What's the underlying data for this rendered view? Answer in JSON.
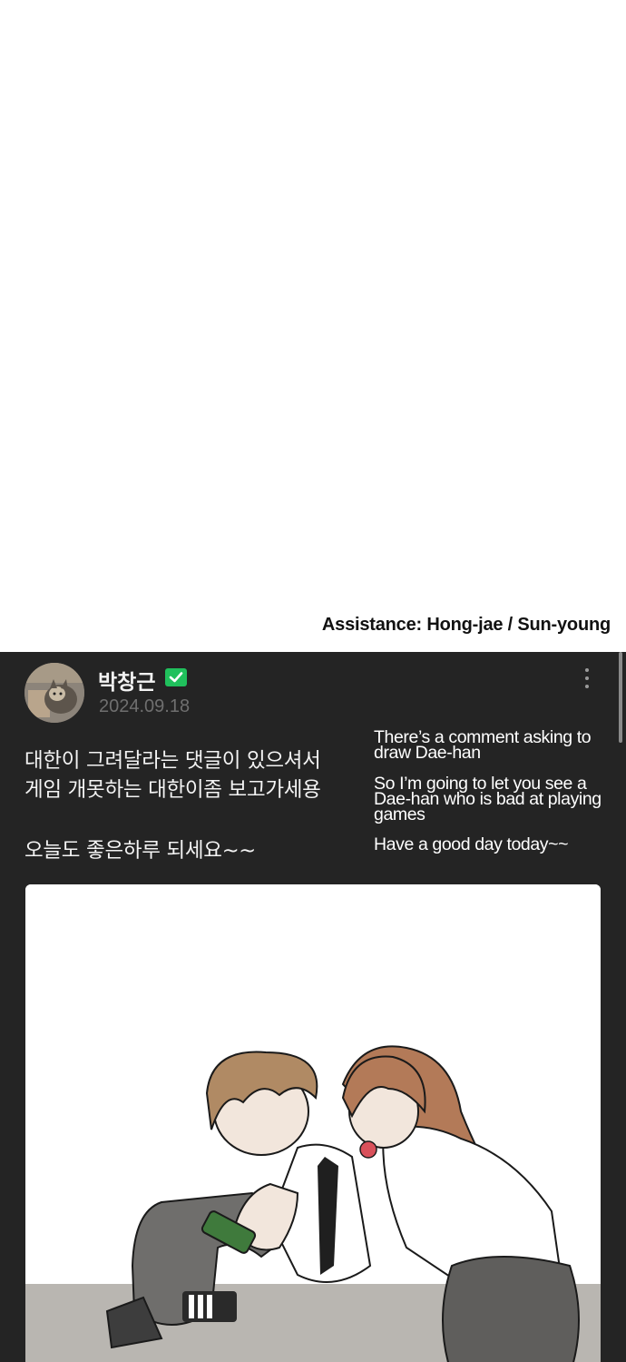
{
  "credit": {
    "text": "Assistance: Hong-jae / Sun-young"
  },
  "post": {
    "author": "박창근",
    "date": "2024.09.18",
    "verified_icon": "verified-check-icon",
    "more_icon": "more-vertical-icon",
    "korean_lines": [
      "대한이 그려달라는 댓글이 있으셔서",
      "게임 개못하는 대한이좀 보고가세용",
      "오늘도 좋은하루 되세요~~"
    ],
    "translation_lines": [
      "There’s a comment asking to draw Dae-han",
      "So I’m going to let you see a Dae-han who is bad at playing games",
      "Have a good day today~~"
    ]
  },
  "colors": {
    "post_bg": "#242424",
    "verified_green": "#20c05c",
    "date_gray": "#6f6f6f"
  }
}
